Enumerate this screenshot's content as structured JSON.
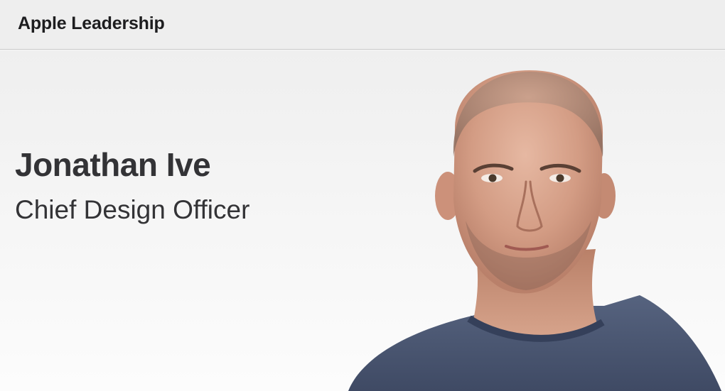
{
  "nav": {
    "title": "Apple Leadership"
  },
  "profile": {
    "name": "Jonathan Ive",
    "role": "Chief Design Officer",
    "portrait": {
      "icon": "portrait-photo",
      "shirt_color": "#4a5773",
      "skin_color": "#d9a48c",
      "background_color": "#f3f3f3"
    }
  }
}
